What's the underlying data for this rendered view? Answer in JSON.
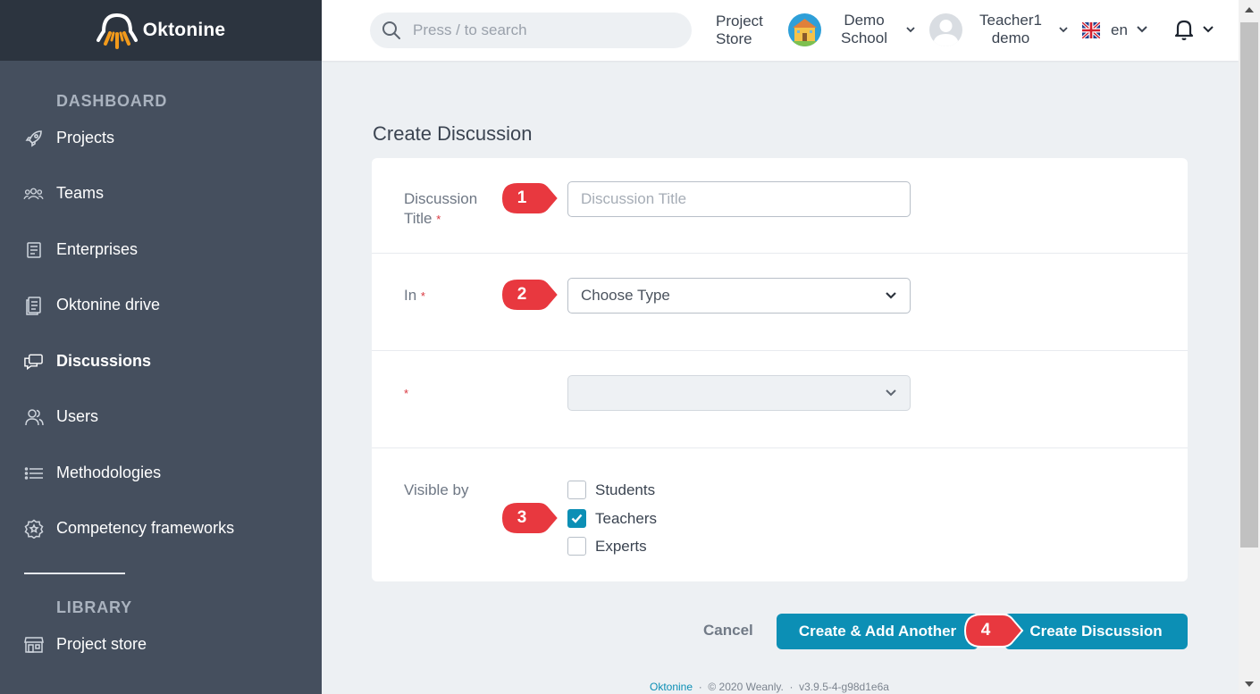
{
  "app": {
    "name": "Oktonine"
  },
  "search": {
    "placeholder": "Press / to search"
  },
  "topbar": {
    "project_store": [
      "Project",
      "Store"
    ],
    "school": [
      "Demo",
      "School"
    ],
    "user": [
      "Teacher1",
      "demo"
    ],
    "language": "en"
  },
  "sidebar": {
    "dashboard_title": "DASHBOARD",
    "library_title": "LIBRARY",
    "items": [
      {
        "label": "Projects",
        "icon": "rocket-icon"
      },
      {
        "label": "Teams",
        "icon": "team-icon"
      },
      {
        "label": "Enterprises",
        "icon": "enterprise-icon"
      },
      {
        "label": "Oktonine drive",
        "icon": "drive-icon"
      },
      {
        "label": "Discussions",
        "icon": "discussions-icon",
        "active": true
      },
      {
        "label": "Users",
        "icon": "users-icon"
      },
      {
        "label": "Methodologies",
        "icon": "list-icon"
      },
      {
        "label": "Competency frameworks",
        "icon": "badge-icon"
      }
    ],
    "library_items": [
      {
        "label": "Project store",
        "icon": "store-icon"
      }
    ]
  },
  "form": {
    "title": "Create Discussion",
    "title_label": [
      "Discussion",
      "Title"
    ],
    "title_placeholder": "Discussion Title",
    "in_label": "In",
    "in_select": "Choose Type",
    "second_select": "",
    "visible_by_label": "Visible by",
    "required_mark": "*",
    "visibility": [
      {
        "label": "Students",
        "checked": false
      },
      {
        "label": "Teachers",
        "checked": true
      },
      {
        "label": "Experts",
        "checked": false
      }
    ]
  },
  "actions": {
    "cancel": "Cancel",
    "create_add_another": "Create & Add Another",
    "create": "Create Discussion"
  },
  "markers": [
    "1",
    "2",
    "3",
    "4"
  ],
  "footer": {
    "link": "Oktonine",
    "sep": "·",
    "copyright": "© 2020 Weanly.",
    "version": "v3.9.5-4-g98d1e6a"
  },
  "colors": {
    "sidebar_bg": "#454f5e",
    "logo_bar_bg": "#2c343f",
    "primary": "#0c8fb5",
    "marker": "#e8383f",
    "required": "#d9363e"
  }
}
